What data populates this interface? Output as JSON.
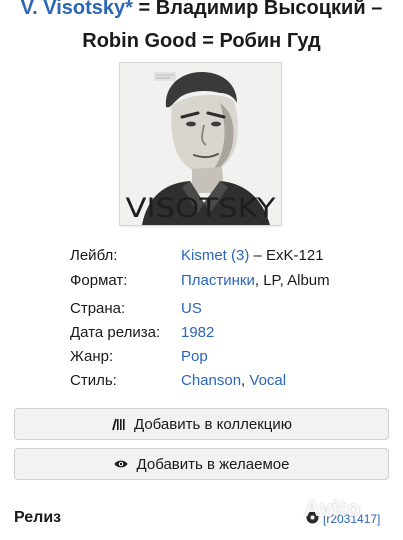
{
  "header": {
    "artist_link": "V. Visotsky*",
    "title_line1_rest": " = Владимир Высоцкий –",
    "title_line2": "Robin Good = Робин Гуд"
  },
  "cover": {
    "text": "VISOTSKY"
  },
  "details": {
    "label": {
      "label": "Лейбл:",
      "link": "Kismet (3)",
      "rest": " – ExK-121"
    },
    "format": {
      "label": "Формат:",
      "link": "Пластинки",
      "rest": ", LP, Album"
    },
    "country": {
      "label": "Страна:",
      "link": "US"
    },
    "released": {
      "label": "Дата релиза:",
      "link": "1982"
    },
    "genre": {
      "label": "Жанр:",
      "link": "Pop"
    },
    "style": {
      "label": "Стиль:",
      "link1": "Chanson",
      "sep": ", ",
      "link2": "Vocal"
    }
  },
  "actions": {
    "add_collection": "Добавить в коллекцию",
    "add_wantlist": "Добавить в желаемое"
  },
  "release": {
    "heading": "Релиз",
    "id": "[r2031417]"
  },
  "watermark": "Avito",
  "colors": {
    "link": "#2a66b8",
    "button_bg": "#f2f2f2",
    "button_border": "#cfcfcf"
  },
  "icons": {
    "collection": "vinyl-collection-icon",
    "wantlist": "eye-icon",
    "release_id": "disc-icon"
  }
}
